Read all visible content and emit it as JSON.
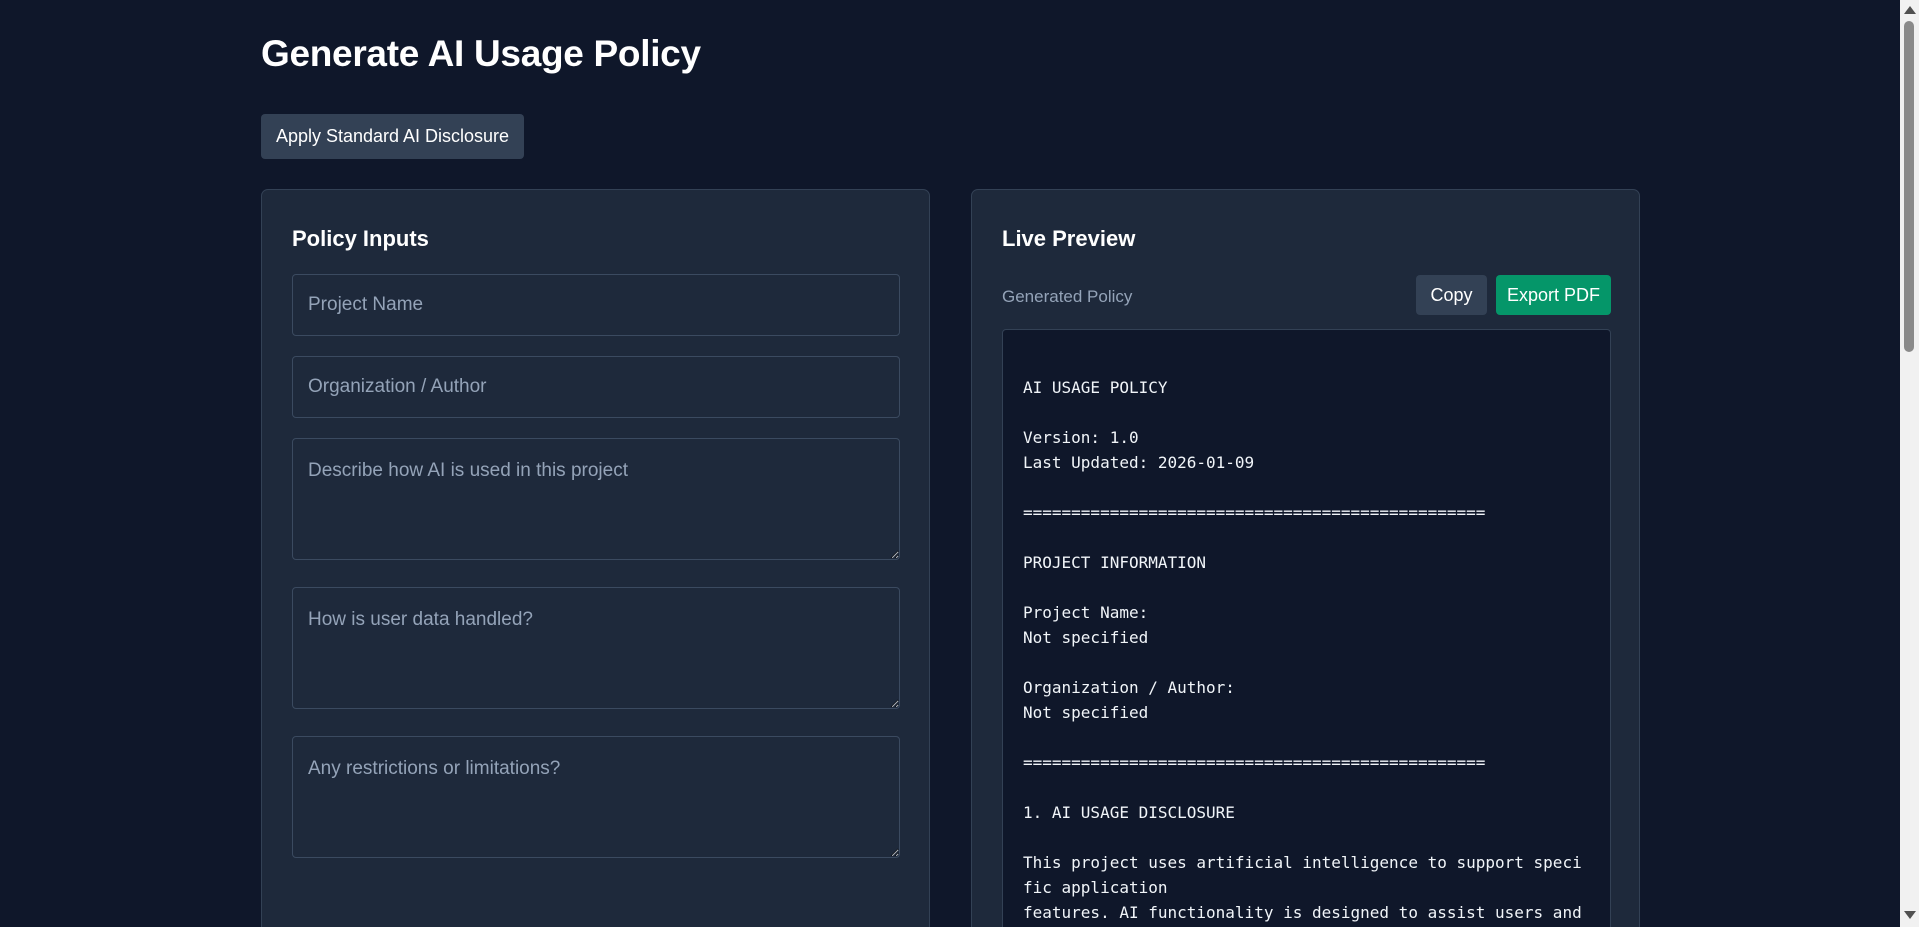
{
  "page": {
    "title": "Generate AI Usage Policy",
    "standard_disclosure_label": "Apply Standard AI Disclosure"
  },
  "inputs_panel": {
    "heading": "Policy Inputs",
    "project_name_placeholder": "Project Name",
    "organization_placeholder": "Organization / Author",
    "ai_usage_placeholder": "Describe how AI is used in this project",
    "data_handling_placeholder": "How is user data handled?",
    "restrictions_placeholder": "Any restrictions or limitations?"
  },
  "preview_panel": {
    "heading": "Live Preview",
    "label": "Generated Policy",
    "copy_label": "Copy",
    "export_label": "Export PDF",
    "text": "AI USAGE POLICY\n\nVersion: 1.0\nLast Updated: 2026-01-09\n\n================================================\n\nPROJECT INFORMATION\n\nProject Name:\nNot specified\n\nOrganization / Author:\nNot specified\n\n================================================\n\n1. AI USAGE DISCLOSURE\n\nThis project uses artificial intelligence to support specific application\nfeatures. AI functionality is designed to assist users and"
  },
  "colors": {
    "background": "#0f172a",
    "panel": "#1e293b",
    "secondary_button": "#334155",
    "export_button": "#059669",
    "muted_text": "#94a3b8"
  }
}
